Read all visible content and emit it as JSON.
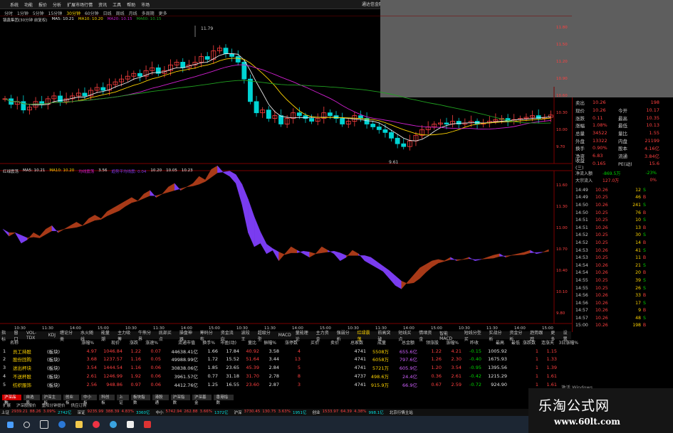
{
  "menubar": {
    "items": [
      "系统",
      "功能",
      "报价",
      "分析",
      "扩展市场行情",
      "资讯",
      "工具",
      "帮助",
      "市场"
    ],
    "alert": "通达信金融终"
  },
  "periodbar": {
    "items": [
      "分时",
      "1分钟",
      "5分钟",
      "15分钟",
      "30分钟",
      "60分钟",
      "日线",
      "周线",
      "月线",
      "多周期",
      "更多"
    ],
    "active_index": 4
  },
  "main_legend": {
    "title": "镇鑫集团(30分钟 前复权)",
    "ma5": "MA5: 10.21",
    "ma10": "MA10: 10.20",
    "ma20": "MA20: 10.15",
    "ma60": "MA60: 10.15"
  },
  "sub_legend": {
    "title": "红绿震荡",
    "ma5": "MA5: 10.21",
    "ma10": "MA10: 10.20",
    "tag": "均线震荡",
    "v1": "3.56",
    "v2": "趋势平均线震: 0.04",
    "v3": "10.20",
    "v4": "10.05",
    "v5": "10.23"
  },
  "chart_labels": {
    "high_marker": "11.79",
    "low_marker": "9.61",
    "main_axis": [
      "11.80",
      "11.50",
      "11.20",
      "10.90",
      "10.60",
      "10.30",
      "10.00",
      "9.70"
    ],
    "sub_axis": [
      "11.60",
      "11.30",
      "11.00",
      "10.70",
      "10.40",
      "10.10",
      "9.80"
    ],
    "time_axis": [
      "10:30",
      "11:30",
      "14:00",
      "15:00",
      "10:30",
      "11:30",
      "14:00",
      "15:00",
      "10:30",
      "11:30",
      "14:00",
      "15:00",
      "10:30",
      "11:30",
      "14:00",
      "15:00",
      "10:30",
      "11:30",
      "14:00",
      "15:00"
    ]
  },
  "quote": {
    "rows": [
      {
        "l1": "卖出",
        "v1": "10.26",
        "l2": "",
        "v2": "198"
      },
      {
        "l1": "现价",
        "v1": "10.26",
        "l2": "今开",
        "v2": "10.17"
      },
      {
        "l1": "涨跌",
        "v1": "0.11",
        "l2": "最高",
        "v2": "10.35"
      },
      {
        "l1": "涨幅",
        "v1": "1.08%",
        "l2": "最低",
        "v2": "10.13"
      },
      {
        "l1": "总量",
        "v1": "34522",
        "l2": "量比",
        "v2": "1.55"
      },
      {
        "l1": "外盘",
        "v1": "13322",
        "l2": "内盘",
        "v2": "21199"
      },
      {
        "l1": "换手",
        "v1": "0.90%",
        "l2": "股本",
        "v2": "4.16亿"
      },
      {
        "l1": "净资",
        "v1": "6.83",
        "l2": "流通",
        "v2": "3.84亿"
      },
      {
        "l1": "收益(三)",
        "v1": "0.165",
        "l2": "PE(动)",
        "v2": "15.6"
      }
    ]
  },
  "flow": {
    "rows": [
      {
        "c1": "净流入额",
        "c2": "-869.5万",
        "c3": "",
        "c4": "-23%",
        "c5": ""
      },
      {
        "c1": "大宗流入",
        "c2": "127.0万",
        "c3": "",
        "c4": "0%",
        "c5": ""
      }
    ]
  },
  "ticks": [
    {
      "t": "14:49",
      "p": "10.26",
      "v": "12",
      "d": "S"
    },
    {
      "t": "14:49",
      "p": "10.25",
      "v": "46",
      "d": "B"
    },
    {
      "t": "14:50",
      "p": "10.26",
      "v": "241",
      "d": "S"
    },
    {
      "t": "14:50",
      "p": "10.25",
      "v": "76",
      "d": "B"
    },
    {
      "t": "14:51",
      "p": "10.25",
      "v": "10",
      "d": "S"
    },
    {
      "t": "14:51",
      "p": "10.26",
      "v": "13",
      "d": "B"
    },
    {
      "t": "14:52",
      "p": "10.25",
      "v": "30",
      "d": "S"
    },
    {
      "t": "14:52",
      "p": "10.25",
      "v": "14",
      "d": "B"
    },
    {
      "t": "14:53",
      "p": "10.26",
      "v": "41",
      "d": "S"
    },
    {
      "t": "14:53",
      "p": "10.25",
      "v": "11",
      "d": "B"
    },
    {
      "t": "14:54",
      "p": "10.26",
      "v": "21",
      "d": "S"
    },
    {
      "t": "14:54",
      "p": "10.26",
      "v": "20",
      "d": "B"
    },
    {
      "t": "14:55",
      "p": "10.25",
      "v": "39",
      "d": "S"
    },
    {
      "t": "14:55",
      "p": "10.25",
      "v": "26",
      "d": "S"
    },
    {
      "t": "14:56",
      "p": "10.26",
      "v": "33",
      "d": "B"
    },
    {
      "t": "14:56",
      "p": "10.26",
      "v": "17",
      "d": "S"
    },
    {
      "t": "14:57",
      "p": "10.26",
      "v": "9",
      "d": "B"
    },
    {
      "t": "14:57",
      "p": "10.26",
      "v": "48",
      "d": "S"
    },
    {
      "t": "15:00",
      "p": "10.26",
      "v": "198",
      "d": "B"
    }
  ],
  "bottom_tabs": {
    "items": [
      "指标",
      "窗口",
      "VOL-TDX",
      "KDJ",
      "缠论分类",
      "水火随线",
      "能量潮",
      "主力吸筹",
      "牛熊分界",
      "底部买点",
      "操盘神器",
      "筹码分布",
      "资金流向",
      "波段王",
      "超级分型",
      "MACD",
      "量能理论",
      "主力资金",
      "强弱分析",
      "红绿震荡",
      "前高突破",
      "短线买点",
      "情绪资金",
      "智能MACD",
      "短线分型买",
      "实战分析",
      "资金分析",
      "趋势跟踪",
      "更多",
      "设置"
    ],
    "active_index": 19
  },
  "table_header": [
    "",
    "名称",
    "",
    "涨幅%",
    "现价",
    "涨跌",
    "涨速%",
    "流通市值",
    "换手%",
    "市盈(动)",
    "量比",
    "振幅%",
    "涨停数",
    "买价",
    "卖价",
    "总家数",
    "成量",
    "总金额",
    "领涨股",
    "涨幅%",
    "昨收",
    "最高",
    "最低",
    "涨跌数",
    "连涨天",
    "3日涨幅%"
  ],
  "table_rows": [
    {
      "idx": "1",
      "name": "员工持股",
      "tag": "(板块)",
      "chg": "4.97",
      "price": "1046.84",
      "up": "1.22",
      "speed": "0.07",
      "mcap": "44638.41亿",
      "turn": "1.66",
      "pe": "17.84",
      "vr": "40.92",
      "amp": "3.58",
      "limit": "4",
      "total": "4741",
      "vol": "5508万",
      "amt": "655.6亿",
      "lead": "1.22",
      "leadpct": "4.21",
      "prev": "-0.15",
      "high": "1005.92",
      "low": "",
      "cnt": "1",
      "days": "1.15"
    },
    {
      "idx": "2",
      "name": "股份回购",
      "tag": "(板块)",
      "chg": "3.68",
      "price": "1237.57",
      "up": "1.16",
      "speed": "0.05",
      "mcap": "49988.99亿",
      "turn": "1.72",
      "pe": "15.52",
      "vr": "51.64",
      "amp": "3.44",
      "limit": "13",
      "total": "4741",
      "vol": "6058万",
      "amt": "797.6亿",
      "lead": "1.26",
      "leadpct": "2.30",
      "prev": "-0.40",
      "high": "1675.93",
      "low": "",
      "cnt": "1",
      "days": "1.33"
    },
    {
      "idx": "3",
      "name": "送出杯块",
      "tag": "(板块)",
      "chg": "3.54",
      "price": "1444.54",
      "up": "1.16",
      "speed": "0.06",
      "mcap": "30838.06亿",
      "turn": "1.85",
      "pe": "23.65",
      "vr": "45.39",
      "amp": "2.84",
      "limit": "5",
      "total": "4741",
      "vol": "5721万",
      "amt": "605.9亿",
      "lead": "1.20",
      "leadpct": "3.54",
      "prev": "-0.95",
      "high": "1395.56",
      "low": "",
      "cnt": "1",
      "days": "1.39"
    },
    {
      "idx": "4",
      "name": "不送杯股",
      "tag": "(板块)",
      "chg": "2.61",
      "price": "1246.99",
      "up": "1.92",
      "speed": "0.06",
      "mcap": "3961.57亿",
      "turn": "0.77",
      "pe": "31.18",
      "vr": "31.70",
      "amp": "2.78",
      "limit": "8",
      "total": "4737",
      "vol": "498.6万",
      "amt": "24.4亿",
      "lead": "0.36",
      "leadpct": "2.61",
      "prev": "-0.42",
      "high": "1215.29",
      "low": "",
      "cnt": "1",
      "days": "1.61"
    },
    {
      "idx": "5",
      "name": "纺织服饰",
      "tag": "(板块)",
      "chg": "2.56",
      "price": "948.86",
      "up": "0.97",
      "speed": "0.06",
      "mcap": "4412.76亿",
      "turn": "1.25",
      "pe": "16.55",
      "vr": "23.60",
      "amp": "2.87",
      "limit": "3",
      "total": "4741",
      "vol": "915.9万",
      "amt": "66.9亿",
      "lead": "0.67",
      "leadpct": "2.59",
      "prev": "-0.72",
      "high": "924.90",
      "low": "",
      "cnt": "1",
      "days": "1.61"
    }
  ],
  "sector_tabs": {
    "items": [
      "沪深品种",
      "自选股",
      "沪深主板",
      "创业板",
      "中小板",
      "科创板",
      "上证",
      "板块指数",
      "港股通",
      "沪深指数",
      "沪深基金",
      "香港指数"
    ],
    "active_index": 0
  },
  "newsbar": {
    "items": [
      "扩展",
      "沪深股报价",
      "重阳分钟提价",
      "供应订购"
    ]
  },
  "indexbar": {
    "items": [
      {
        "label": "上证",
        "v": "2939.21",
        "c": "88.26",
        "p": "3.09%",
        "a": "2742亿"
      },
      {
        "label": "深证",
        "v": "9235.99",
        "c": "388.39",
        "p": "4.83%",
        "a": "3360亿"
      },
      {
        "label": "中小",
        "v": "5742.94",
        "c": "262.88",
        "p": "3.66%",
        "a": "1372亿"
      },
      {
        "label": "沪深",
        "v": "3730.45",
        "c": "130.75",
        "p": "3.63%",
        "a": "1951亿"
      },
      {
        "label": "创业",
        "v": "1533.97",
        "c": "64.39",
        "p": "4.38%",
        "a": "998.1亿"
      }
    ],
    "right": "北京行情主站"
  },
  "activate_text": "激活 Windows",
  "watermark": {
    "cn": "乐淘公式网",
    "url": "www.60lt.com"
  },
  "colors": {
    "up": "#ff4040",
    "down": "#00d4d4",
    "red_fill": "#a83a18",
    "purple_fill": "#7a3cf0",
    "ma5": "#e8e8e8",
    "ma10": "#ffd400",
    "ma20": "#d020d0",
    "ma60": "#20a020"
  }
}
